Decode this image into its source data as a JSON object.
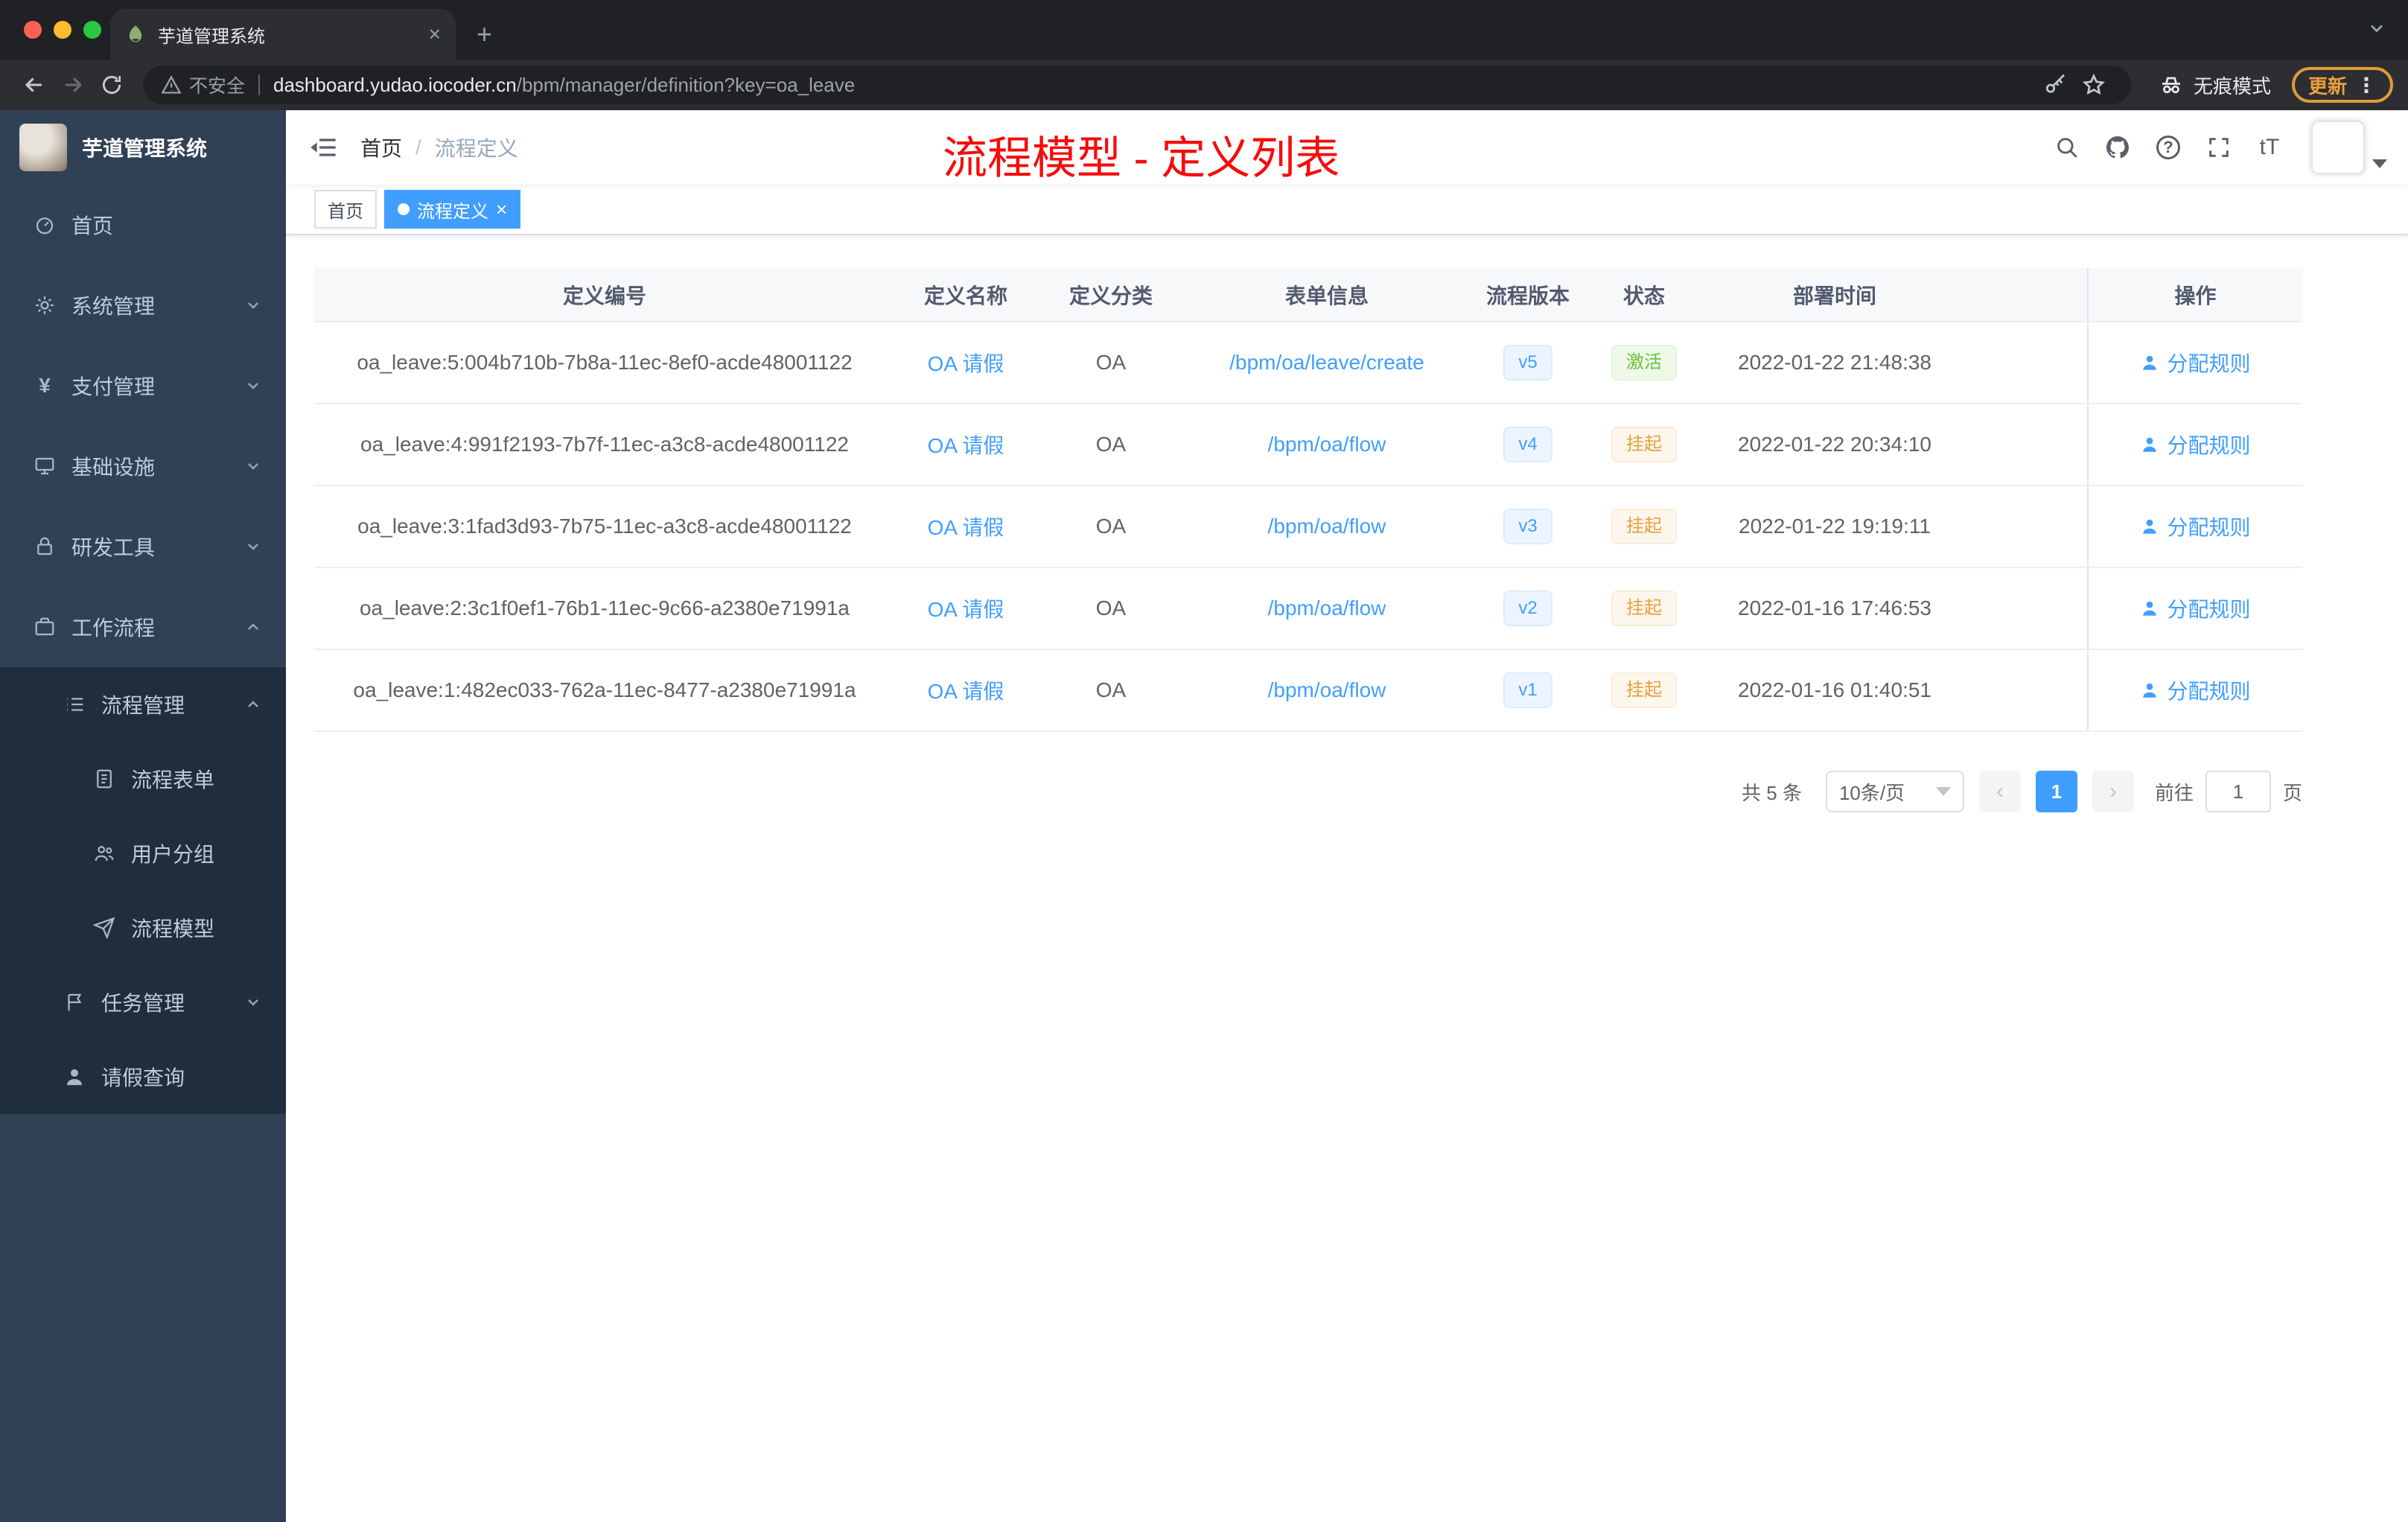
{
  "colors": {
    "accent": "#409eff",
    "success": "#67c23a",
    "warning": "#e6a23c",
    "annotation_red": "#f70b0b",
    "sidebar_bg": "#304156",
    "submenu_bg": "#1f2d3d"
  },
  "icons": {
    "yen": "¥",
    "close": "×",
    "plus": "+",
    "kebab": "⋮",
    "question": "?",
    "text_size": "tT",
    "prev": "‹",
    "next": "›"
  },
  "browser": {
    "tab_title": "芋道管理系统",
    "security_label": "不安全",
    "url_host": "dashboard.yudao.iocoder.cn",
    "url_path": "/bpm/manager/definition?key=oa_leave",
    "incognito_label": "无痕模式",
    "update_label": "更新"
  },
  "sidebar": {
    "logo_title": "芋道管理系统",
    "items": [
      {
        "label": "首页"
      },
      {
        "label": "系统管理"
      },
      {
        "label": "支付管理"
      },
      {
        "label": "基础设施"
      },
      {
        "label": "研发工具"
      },
      {
        "label": "工作流程"
      },
      {
        "label": "流程管理"
      },
      {
        "label": "流程表单"
      },
      {
        "label": "用户分组"
      },
      {
        "label": "流程模型"
      },
      {
        "label": "任务管理"
      },
      {
        "label": "请假查询"
      }
    ]
  },
  "navbar": {
    "breadcrumb": [
      "首页",
      "流程定义"
    ],
    "breadcrumb_separator": "/",
    "annotation": "流程模型 - 定义列表"
  },
  "tags": {
    "items": [
      {
        "label": "首页"
      },
      {
        "label": "流程定义"
      }
    ]
  },
  "table": {
    "columns": [
      "定义编号",
      "定义名称",
      "定义分类",
      "表单信息",
      "流程版本",
      "状态",
      "部署时间",
      "操作"
    ],
    "rows": [
      {
        "id": "oa_leave:5:004b710b-7b8a-11ec-8ef0-acde48001122",
        "name": "OA 请假",
        "category": "OA",
        "form": "/bpm/oa/leave/create",
        "version": "v5",
        "status": "激活",
        "time": "2022-01-22 21:48:38",
        "action": "分配规则"
      },
      {
        "id": "oa_leave:4:991f2193-7b7f-11ec-a3c8-acde48001122",
        "name": "OA 请假",
        "category": "OA",
        "form": "/bpm/oa/flow",
        "version": "v4",
        "status": "挂起",
        "time": "2022-01-22 20:34:10",
        "action": "分配规则"
      },
      {
        "id": "oa_leave:3:1fad3d93-7b75-11ec-a3c8-acde48001122",
        "name": "OA 请假",
        "category": "OA",
        "form": "/bpm/oa/flow",
        "version": "v3",
        "status": "挂起",
        "time": "2022-01-22 19:19:11",
        "action": "分配规则"
      },
      {
        "id": "oa_leave:2:3c1f0ef1-76b1-11ec-9c66-a2380e71991a",
        "name": "OA 请假",
        "category": "OA",
        "form": "/bpm/oa/flow",
        "version": "v2",
        "status": "挂起",
        "time": "2022-01-16 17:46:53",
        "action": "分配规则"
      },
      {
        "id": "oa_leave:1:482ec033-762a-11ec-8477-a2380e71991a",
        "name": "OA 请假",
        "category": "OA",
        "form": "/bpm/oa/flow",
        "version": "v1",
        "status": "挂起",
        "time": "2022-01-16 01:40:51",
        "action": "分配规则"
      }
    ]
  },
  "pagination": {
    "total": "共 5 条",
    "page_size": "10条/页",
    "current": "1",
    "goto": "前往",
    "goto_value": "1",
    "unit": "页"
  }
}
